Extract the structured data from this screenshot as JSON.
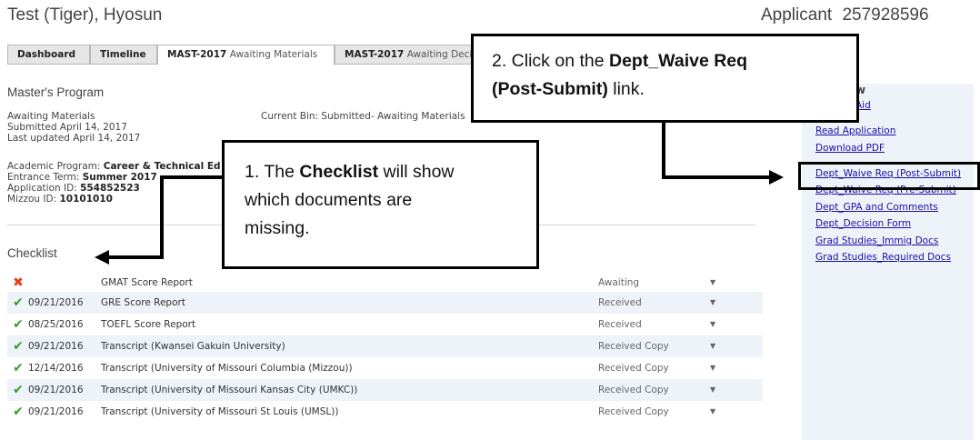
{
  "header": {
    "applicant_name": "Test (Tiger), Hyosun",
    "applicant_label": "Applicant",
    "applicant_id": "257928596"
  },
  "tabs": [
    {
      "bold": "Dashboard",
      "sub": ""
    },
    {
      "bold": "Timeline",
      "sub": ""
    },
    {
      "bold": "MAST-2017",
      "sub": "Awaiting Materials"
    },
    {
      "bold": "MAST-2017",
      "sub": "Awaiting Decisi"
    }
  ],
  "program": {
    "title": "Master's Program",
    "status": "Awaiting Materials",
    "submitted": "Submitted April 14, 2017",
    "updated": "Last updated April 14, 2017",
    "current_bin": "Current Bin: Submitted- Awaiting Materials",
    "academic_label": "Academic Program: ",
    "academic_value": "Career & Technical Ed",
    "term_label": "Entrance Term: ",
    "term_value": "Summer 2017",
    "appid_label": "Application ID: ",
    "appid_value": "554852523",
    "mizzou_label": "Mizzou ID: ",
    "mizzou_value": "10101010"
  },
  "checklist": {
    "title": "Checklist",
    "rows": [
      {
        "icon": "x-icon",
        "date": "",
        "item": "GMAT Score Report",
        "status": "Awaiting"
      },
      {
        "icon": "check-icon",
        "date": "09/21/2016",
        "item": "GRE Score Report",
        "status": "Received"
      },
      {
        "icon": "check-icon",
        "date": "08/25/2016",
        "item": "TOEFL Score Report",
        "status": "Received"
      },
      {
        "icon": "check-icon",
        "date": "09/21/2016",
        "item": "Transcript (Kwansei Gakuin University)",
        "status": "Received Copy"
      },
      {
        "icon": "check-icon",
        "date": "12/14/2016",
        "item": "Transcript (University of Missouri Columbia (Mizzou))",
        "status": "Received Copy"
      },
      {
        "icon": "check-icon",
        "date": "09/21/2016",
        "item": "Transcript (University of Missouri Kansas City (UMKC))",
        "status": "Received Copy"
      },
      {
        "icon": "check-icon",
        "date": "09/21/2016",
        "item": "Transcript (University of Missouri St Louis (UMSL))",
        "status": "Received Copy"
      }
    ]
  },
  "sidebar": {
    "header_fragment": "w",
    "aid_fragment": "Aid",
    "links": [
      "Read Application",
      "Download PDF",
      "Dept_Waive Req (Post-Submit)",
      "Dept_Waive Req (Pre-Submit)",
      "Dept_GPA and Comments",
      "Dept_Decision Form",
      "Grad Studies_Immig Docs",
      "Grad Studies_Required Docs"
    ]
  },
  "callouts": {
    "step1_pre": "1. The ",
    "step1_bold": "Checklist",
    "step1_post_a": " will show",
    "step1_line2": "which documents are",
    "step1_line3": "missing.",
    "step2_pre": "2. Click on the ",
    "step2_bold_a": "Dept_Waive Req",
    "step2_bold_b": "(Post-Submit)",
    "step2_post": " link."
  },
  "colors": {
    "link": "#1a0dab",
    "check": "#3a9b2c",
    "x": "#e0411c",
    "row_alt": "#edf3f8"
  }
}
